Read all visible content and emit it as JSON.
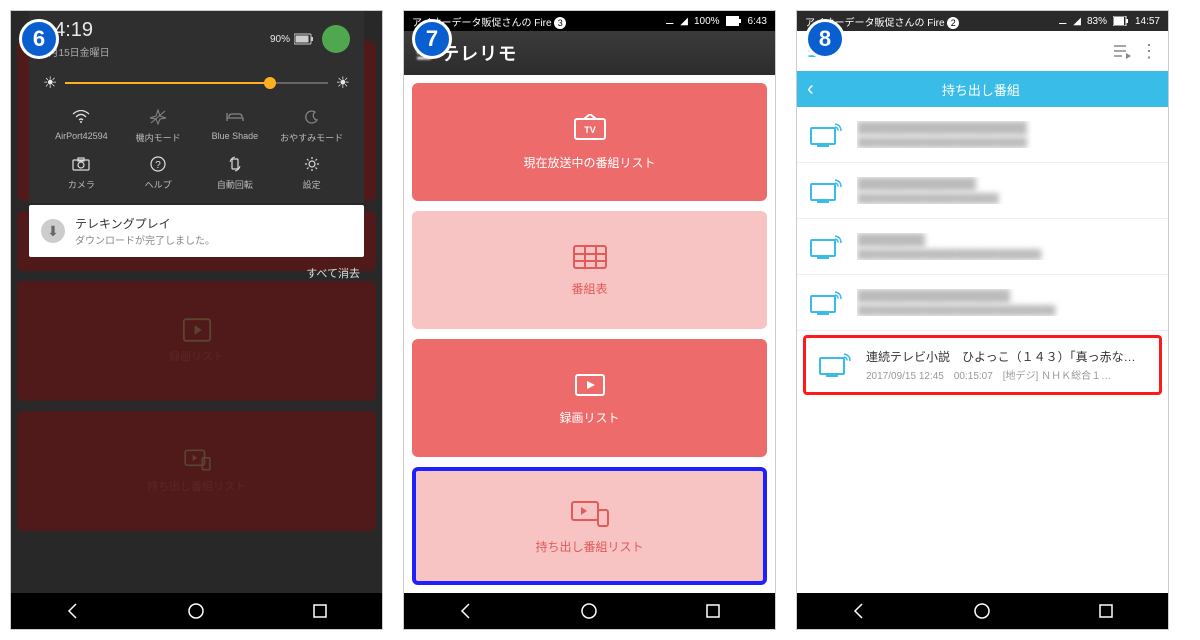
{
  "badges": {
    "s6": "6",
    "s7": "7",
    "s8": "8"
  },
  "screen6": {
    "status": {
      "battery": "90%"
    },
    "time": "14:19",
    "date": "9月15日金曜日",
    "panelBattery": "90%",
    "qs1": [
      {
        "label": "AirPort42594"
      },
      {
        "label": "機内モード"
      },
      {
        "label": "Blue Shade"
      },
      {
        "label": "おやすみモード"
      }
    ],
    "qs2": [
      {
        "label": "カメラ"
      },
      {
        "label": "ヘルプ"
      },
      {
        "label": "自動回転"
      },
      {
        "label": "設定"
      }
    ],
    "notif": {
      "title": "テレキングプレイ",
      "sub": "ダウンロードが完了しました。"
    },
    "clearAll": "すべて消去",
    "bgTiles": [
      "録画リスト",
      "持ち出し番組リスト"
    ]
  },
  "screen7": {
    "status": {
      "user": "アイオーデータ販促さんの Fire",
      "badge": "3",
      "battery": "100%",
      "time": "6:43"
    },
    "appTitle": "テレリモ",
    "cards": [
      {
        "label": "現在放送中の番組リスト",
        "style": "red",
        "icon": "tv"
      },
      {
        "label": "番組表",
        "style": "pink",
        "icon": "grid"
      },
      {
        "label": "録画リスト",
        "style": "red",
        "icon": "play"
      },
      {
        "label": "持ち出し番組リスト",
        "style": "pink",
        "icon": "export",
        "highlight": true
      }
    ]
  },
  "screen8": {
    "status": {
      "user": "アイオーデータ販促さんの Fire",
      "badge": "2",
      "battery": "83%",
      "time": "14:57"
    },
    "subheadTitle": "持ち出し番組",
    "items": [
      {
        "blur": true,
        "t1": "████████████████████",
        "t2": "████████████████████████"
      },
      {
        "blur": true,
        "t1": "██████████████",
        "t2": "████████████████████"
      },
      {
        "blur": true,
        "t1": "████████",
        "t2": "██████████████████████████"
      },
      {
        "blur": true,
        "t1": "██████████████████",
        "t2": "████████████████████████████"
      },
      {
        "blur": false,
        "selected": true,
        "t1": "連続テレビ小説　ひよっこ（１４３）「真っ赤なハ…",
        "t2": "2017/09/15 12:45　00:15:07　[地デジ] ＮＨＫ総合１…"
      }
    ]
  }
}
